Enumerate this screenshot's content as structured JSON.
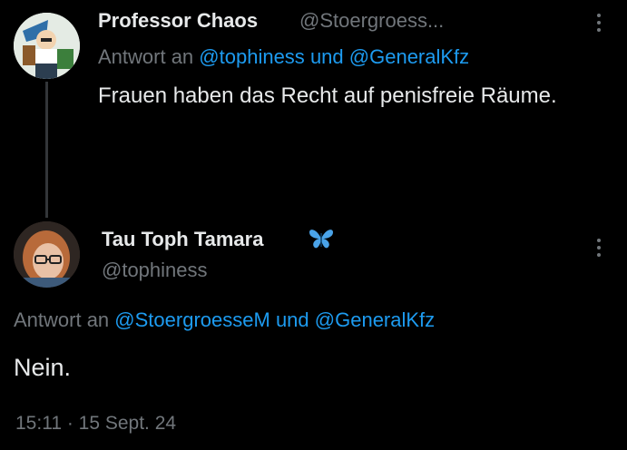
{
  "tweets": [
    {
      "display_name": "Professor Chaos",
      "handle": "@Stoergroess...",
      "reply_prefix": "Antwort an",
      "reply_to_1": "@tophiness",
      "reply_joiner": "und",
      "reply_to_2": "@GeneralKfz",
      "text": "Frauen haben das Recht auf penisfreie Räume.",
      "avatar_icon": "cartoon-avatar-icon"
    },
    {
      "display_name": "Tau Toph Tamara",
      "name_emoji": "butterfly-icon",
      "handle": "@tophiness",
      "reply_prefix": "Antwort an",
      "reply_to_1": "@StoergroesseM",
      "reply_joiner": "und",
      "reply_to_2": "@GeneralKfz",
      "text": "Nein.",
      "timestamp": "15:11 · 15 Sept. 24",
      "avatar_icon": "profile-photo-avatar"
    }
  ],
  "colors": {
    "background": "#000000",
    "text": "#e7e9ea",
    "muted": "#71767b",
    "link": "#1d9bf0",
    "thread_line": "#333639"
  }
}
